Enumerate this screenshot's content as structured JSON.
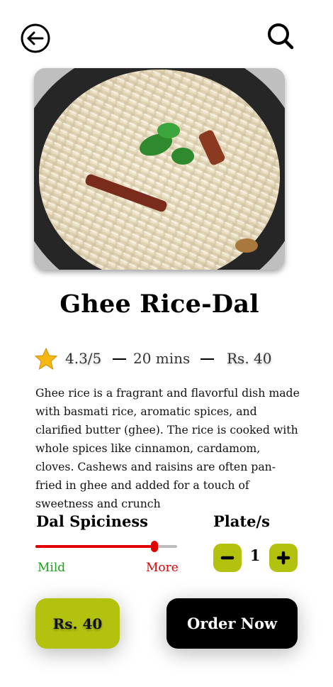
{
  "header": {
    "back_icon": "back-arrow-circle-icon",
    "search_icon": "search-icon"
  },
  "dish": {
    "title": "Ghee Rice-Dal",
    "image_icon": "ghee-rice-photo",
    "rating": "4.3/5",
    "time": "20 mins",
    "price": "Rs. 40",
    "description": "Ghee rice is a fragrant and flavorful dish made with basmati rice, aromatic spices, and clarified butter (ghee). The rice is cooked with whole spices like cinnamon, cardamom, cloves. Cashews and raisins are often pan-fried in ghee and added for a touch of sweetness and crunch"
  },
  "spiciness": {
    "title": "Dal Spiciness",
    "min_label": "Mild",
    "max_label": "More",
    "level": 0.84,
    "colors": {
      "fill": "#e00000",
      "track": "#bdbdbd",
      "mild": "#1aa31a",
      "more": "#e00000"
    }
  },
  "plates": {
    "title": "Plate/s",
    "quantity": "1",
    "minus_icon": "minus-icon",
    "plus_icon": "plus-icon"
  },
  "footer": {
    "price_label": "Rs. 40",
    "order_label": "Order Now"
  },
  "colors": {
    "accent": "#b3c20f",
    "primary_button": "#000000"
  }
}
